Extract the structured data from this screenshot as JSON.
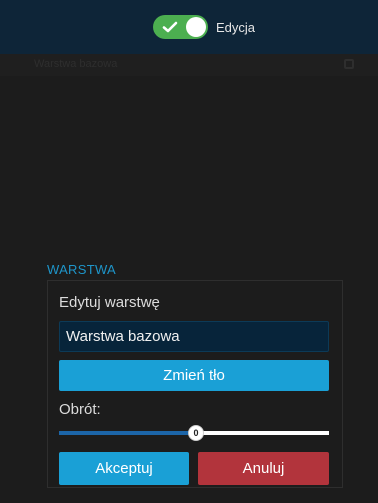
{
  "header": {
    "toggle_label": "Edycja",
    "toggle_on": true
  },
  "background": {
    "title": "Warstwa bazowa"
  },
  "layer_section": {
    "title": "WARSTWA",
    "heading": "Edytuj warstwę",
    "layer_name_value": "Warstwa bazowa",
    "change_background_label": "Zmień tło",
    "rotation_label": "Obrót:",
    "rotation_value": "0",
    "rotation_fraction": 0.5,
    "accept_label": "Akceptuj",
    "cancel_label": "Anuluj"
  },
  "colors": {
    "header_bg": "#0e2538",
    "toggle_on": "#4caf50",
    "accent": "#1aa0d6",
    "danger": "#b2343c",
    "section_title": "#1e95c9"
  },
  "icons": {
    "toggle_check": "check-icon",
    "bg_settings": "settings-icon"
  }
}
